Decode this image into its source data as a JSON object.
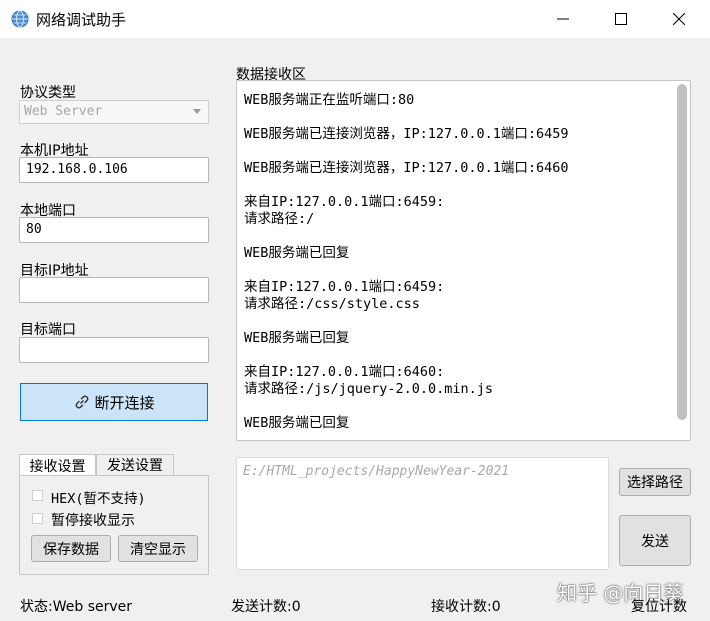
{
  "window": {
    "title": "网络调试助手"
  },
  "left": {
    "protocol_label": "协议类型",
    "protocol_value": "Web Server",
    "local_ip_label": "本机IP地址",
    "local_ip_value": "192.168.0.106",
    "local_port_label": "本地端口",
    "local_port_value": "80",
    "target_ip_label": "目标IP地址",
    "target_ip_value": "",
    "target_port_label": "目标端口",
    "target_port_value": "",
    "disconnect_label": "断开连接"
  },
  "tabs": {
    "receive": "接收设置",
    "send": "发送设置",
    "hex_label": "HEX(暂不支持)",
    "pause_label": "暂停接收显示",
    "save_label": "保存数据",
    "clear_label": "清空显示"
  },
  "receive": {
    "label": "数据接收区",
    "lines": [
      "WEB服务端正在监听端口:80",
      "WEB服务端已连接浏览器，IP:127.0.0.1端口:6459",
      "WEB服务端已连接浏览器，IP:127.0.0.1端口:6460",
      "来自IP:127.0.0.1端口:6459:",
      "请求路径:/",
      "WEB服务端已回复",
      "来自IP:127.0.0.1端口:6459:",
      "请求路径:/css/style.css",
      "WEB服务端已回复",
      "来自IP:127.0.0.1端口:6460:",
      "请求路径:/js/jquery-2.0.0.min.js",
      "WEB服务端已回复"
    ]
  },
  "send": {
    "placeholder": "E:/HTML_projects/HappyNewYear-2021",
    "select_path_label": "选择路径",
    "send_label": "发送"
  },
  "status": {
    "state": "状态:Web server",
    "sent_count": "发送计数:0",
    "recv_count": "接收计数:0",
    "reset_label": "复位计数"
  },
  "watermark": "知乎 @向日葵",
  "icons": {
    "app": "globe-icon",
    "link": "link-icon",
    "minimize": "minimize-icon",
    "maximize": "maximize-icon",
    "close": "close-icon",
    "dropdown": "chevron-down-icon"
  },
  "colors": {
    "accent": "#0078d7",
    "button_active_bg": "#cce4f7",
    "window_bg": "#f0f0f0"
  }
}
